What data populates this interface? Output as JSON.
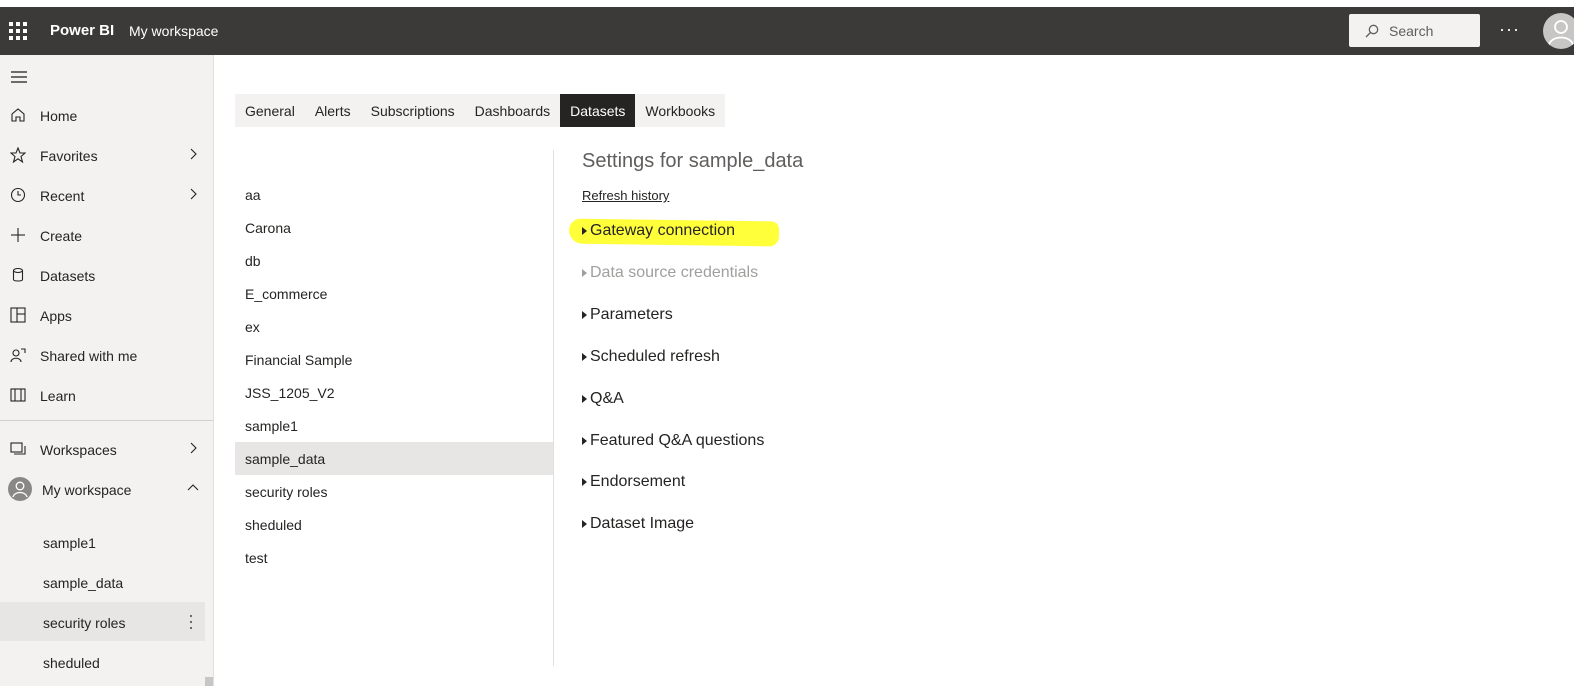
{
  "header": {
    "brand": "Power BI",
    "workspace": "My workspace",
    "search_placeholder": "Search",
    "more": "···"
  },
  "sidebar": {
    "items": [
      {
        "label": "Home",
        "icon": "home-icon"
      },
      {
        "label": "Favorites",
        "icon": "star-icon"
      },
      {
        "label": "Recent",
        "icon": "clock-icon"
      },
      {
        "label": "Create",
        "icon": "plus-icon"
      },
      {
        "label": "Datasets",
        "icon": "database-icon"
      },
      {
        "label": "Apps",
        "icon": "apps-icon"
      },
      {
        "label": "Shared with me",
        "icon": "shared-icon"
      },
      {
        "label": "Learn",
        "icon": "book-icon"
      }
    ],
    "workspaces_label": "Workspaces",
    "my_workspace_label": "My workspace",
    "sub_items": [
      {
        "label": "sample1"
      },
      {
        "label": "sample_data"
      },
      {
        "label": "security roles"
      },
      {
        "label": "sheduled"
      }
    ]
  },
  "tabs": [
    {
      "label": "General"
    },
    {
      "label": "Alerts"
    },
    {
      "label": "Subscriptions"
    },
    {
      "label": "Dashboards"
    },
    {
      "label": "Datasets"
    },
    {
      "label": "Workbooks"
    }
  ],
  "datasets": [
    {
      "label": "aa"
    },
    {
      "label": "Carona"
    },
    {
      "label": "db"
    },
    {
      "label": "E_commerce"
    },
    {
      "label": "ex"
    },
    {
      "label": "Financial Sample"
    },
    {
      "label": "JSS_1205_V2"
    },
    {
      "label": "sample1"
    },
    {
      "label": "sample_data"
    },
    {
      "label": "security roles"
    },
    {
      "label": "sheduled"
    },
    {
      "label": "test"
    }
  ],
  "settings": {
    "title": "Settings for sample_data",
    "refresh_history": "Refresh history",
    "sections": [
      {
        "label": "Gateway connection"
      },
      {
        "label": "Data source credentials"
      },
      {
        "label": "Parameters"
      },
      {
        "label": "Scheduled refresh"
      },
      {
        "label": "Q&A"
      },
      {
        "label": "Featured Q&A questions"
      },
      {
        "label": "Endorsement"
      },
      {
        "label": "Dataset Image"
      }
    ]
  },
  "colors": {
    "topbar": "#3b3a39",
    "sidebar": "#f3f2f1",
    "active_tab": "#252423",
    "highlight": "#ffff3a",
    "disabled_text": "#a19f9d"
  }
}
